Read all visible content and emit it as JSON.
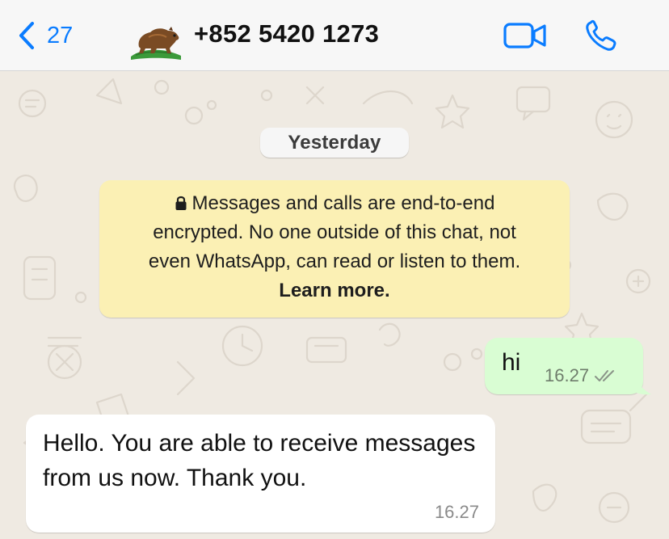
{
  "header": {
    "back_count": "27",
    "contact_title": "+852 5420 1273"
  },
  "chat": {
    "date_divider": "Yesterday",
    "encryption_notice": {
      "line1": "Messages and calls are end-to-end",
      "line2": "encrypted. No one outside of this chat, not",
      "line3": "even WhatsApp, can read or listen to them.",
      "learn_more": "Learn more."
    },
    "messages": [
      {
        "direction": "outgoing",
        "text": "hi",
        "time": "16.27",
        "status": "read"
      },
      {
        "direction": "incoming",
        "text": "Hello. You are able to receive messages from us now. Thank you.",
        "time": "16.27"
      }
    ]
  },
  "colors": {
    "accent": "#0a7cff",
    "header_bg": "#f7f7f7",
    "wallpaper_bg": "#efeae2",
    "outgoing_bubble": "#d9fdd3",
    "incoming_bubble": "#ffffff",
    "notice_bg": "#fbf0b4"
  },
  "icons": [
    "chevron-left-icon",
    "avatar-bear-flag",
    "video-call-icon",
    "phone-call-icon",
    "lock-icon",
    "double-check-icon"
  ]
}
